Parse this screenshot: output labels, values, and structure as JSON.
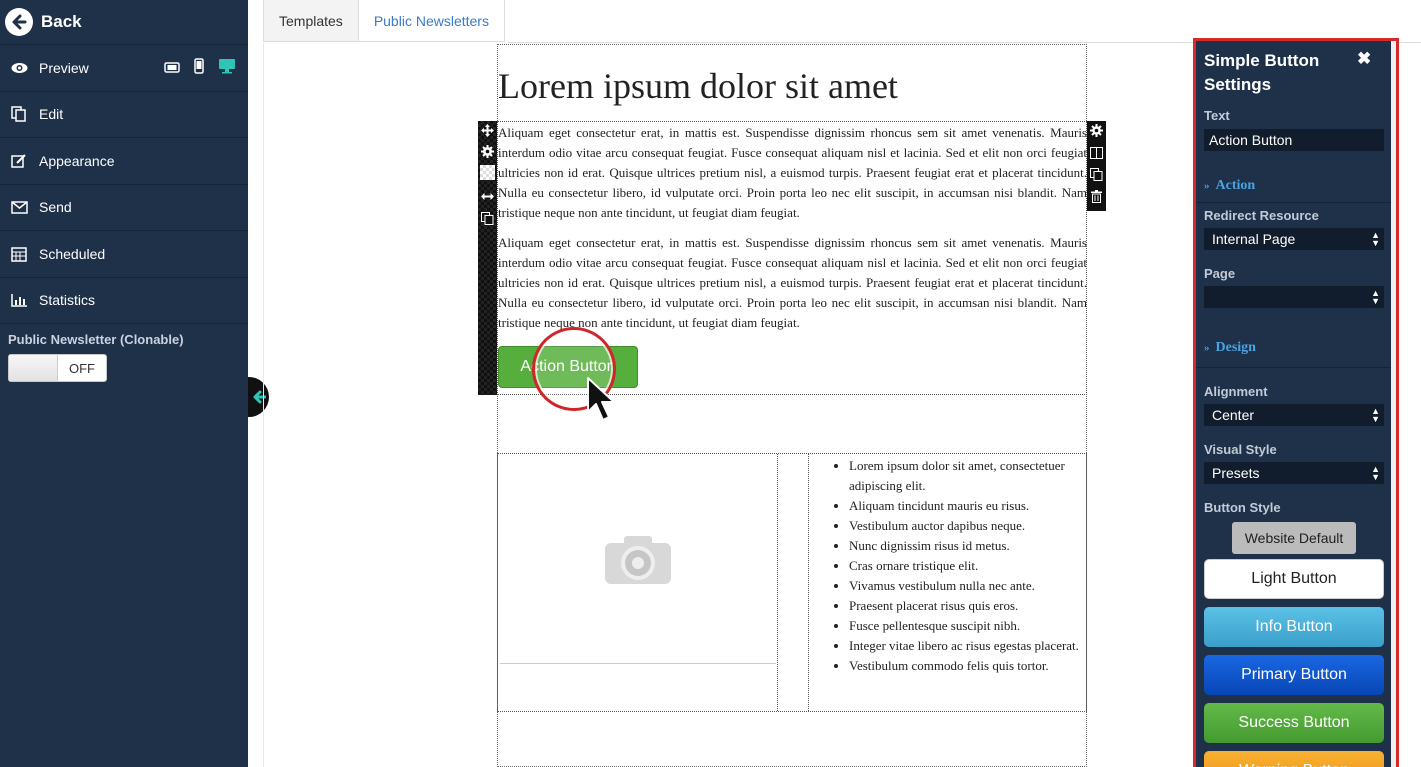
{
  "sidebar": {
    "back": "Back",
    "items": [
      {
        "label": "Preview",
        "icon": "eye-icon"
      },
      {
        "label": "Edit",
        "icon": "copy-icon"
      },
      {
        "label": "Appearance",
        "icon": "pencil-square-icon"
      },
      {
        "label": "Send",
        "icon": "envelope-icon"
      },
      {
        "label": "Scheduled",
        "icon": "calendar-icon"
      },
      {
        "label": "Statistics",
        "icon": "bar-chart-icon"
      }
    ],
    "public_title": "Public Newsletter (Clonable)",
    "toggle_state": "OFF"
  },
  "tabs": [
    {
      "label": "Templates",
      "active": true
    },
    {
      "label": "Public Newsletters",
      "active": false
    }
  ],
  "newsletter": {
    "title": "Lorem ipsum dolor sit amet",
    "paragraphs": [
      "Aliquam eget consectetur erat, in mattis est. Suspendisse dignissim rhoncus sem sit amet venenatis. Mauris interdum odio vitae arcu consequat feugiat. Fusce consequat aliquam nisl et lacinia. Sed et elit non orci feugiat ultricies non id erat. Quisque ultrices pretium nisl, a euismod turpis. Praesent feugiat erat et placerat tincidunt. Nulla eu consectetur libero, id vulputate orci. Proin porta leo nec elit suscipit, in accumsan nisi blandit. Nam tristique neque non ante tincidunt, ut feugiat diam feugiat.",
      "Aliquam eget consectetur erat, in mattis est. Suspendisse dignissim rhoncus sem sit amet venenatis. Mauris interdum odio vitae arcu consequat feugiat. Fusce consequat aliquam nisl et lacinia. Sed et elit non orci feugiat ultricies non id erat. Quisque ultrices pretium nisl, a euismod turpis. Praesent feugiat erat et placerat tincidunt. Nulla eu consectetur libero, id vulputate orci. Proin porta leo nec elit suscipit, in accumsan nisi blandit. Nam tristique neque non ante tincidunt, ut feugiat diam feugiat."
    ],
    "button_label": "Action Button",
    "list_items": [
      "Lorem ipsum dolor sit amet, consectetuer adipiscing elit.",
      "Aliquam tincidunt mauris eu risus.",
      "Vestibulum auctor dapibus neque.",
      "Nunc dignissim risus id metus.",
      "Cras ornare tristique elit.",
      "Vivamus vestibulum nulla nec ante.",
      "Praesent placerat risus quis eros.",
      "Fusce pellentesque suscipit nibh.",
      "Integer vitae libero ac risus egestas placerat.",
      "Vestibulum commodo felis quis tortor."
    ]
  },
  "settings": {
    "title": "Simple Button Settings",
    "close": "✖",
    "text_label": "Text",
    "text_value": "Action Button",
    "action_section": "Action",
    "redirect_label": "Redirect Resource",
    "redirect_value": "Internal Page",
    "page_label": "Page",
    "page_value": "",
    "design_section": "Design",
    "alignment_label": "Alignment",
    "alignment_value": "Center",
    "visual_style_label": "Visual Style",
    "visual_style_value": "Presets",
    "button_style_label": "Button Style",
    "presets": {
      "default": "Website Default",
      "light": "Light Button",
      "info": "Info Button",
      "primary": "Primary Button",
      "success": "Success Button",
      "warning": "Warning Button"
    }
  },
  "colors": {
    "sidebar_bg": "#1f3149",
    "accent_teal": "#2ec4b6",
    "highlight_red": "#d52b2b",
    "link_blue": "#3a7bc8",
    "action_green": "#56ae3d"
  }
}
